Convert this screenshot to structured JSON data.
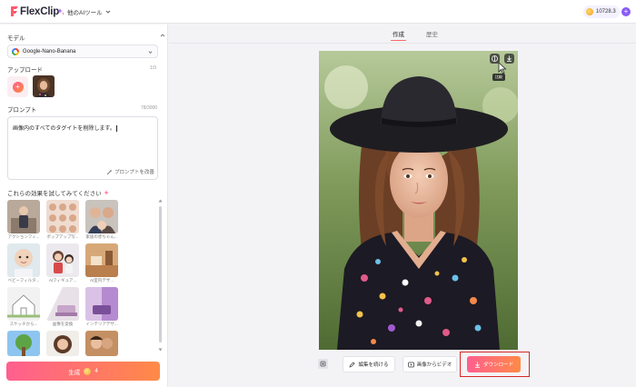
{
  "app": {
    "name": "FlexClip",
    "tools_menu": "他のAIツール",
    "credits": "10728.3",
    "add_label": "+"
  },
  "sidebar": {
    "model_label": "モデル",
    "model_value": "Google-Nano-Banana",
    "upload_label": "アップロード",
    "upload_count": "1/3",
    "prompt_label": "プロンプト",
    "prompt_count": "78/3000",
    "prompt_text": "画像内のすべてのタグイトを削除します。",
    "optimize_label": "プロンプトを改善",
    "effects_label": "これらの効果を試してみてください",
    "effects": [
      {
        "label": "アクションフィ...",
        "icon": "figure-thumbnail"
      },
      {
        "label": "ポップアップ写...",
        "icon": "portrait-grid-thumbnail"
      },
      {
        "label": "家族の赤ちゃん...",
        "icon": "family-thumbnail"
      },
      {
        "label": "ベビーフィルタ...",
        "icon": "baby-thumbnail"
      },
      {
        "label": "AIフィギュア...",
        "icon": "toy-figure-thumbnail"
      },
      {
        "label": "AI室内デザ...",
        "icon": "interior-thumbnail"
      },
      {
        "label": "スケッチから...",
        "icon": "house-sketch-thumbnail"
      },
      {
        "label": "画像を変換",
        "icon": "room-thumbnail"
      },
      {
        "label": "インテリアデザ...",
        "icon": "purple-room-thumbnail"
      },
      {
        "label": "",
        "icon": "tree-thumbnail"
      },
      {
        "label": "",
        "icon": "woman-portrait-thumbnail"
      },
      {
        "label": "",
        "icon": "couple-thumbnail"
      }
    ],
    "generate_label": "生成",
    "generate_cost": "4"
  },
  "main": {
    "tabs": [
      {
        "label": "作成",
        "active": true
      },
      {
        "label": "歴史",
        "active": false
      }
    ],
    "photo_tooltip": "比較",
    "toolbar": {
      "edit_label": "編集を続ける",
      "video_label": "画像からビデオ",
      "download_label": "ダウンロード"
    }
  },
  "colors": {
    "accent_start": "#ff5f8f",
    "accent_end": "#ff8a47",
    "highlight_frame": "#d92828",
    "brand_purple": "#8a5cf6"
  }
}
